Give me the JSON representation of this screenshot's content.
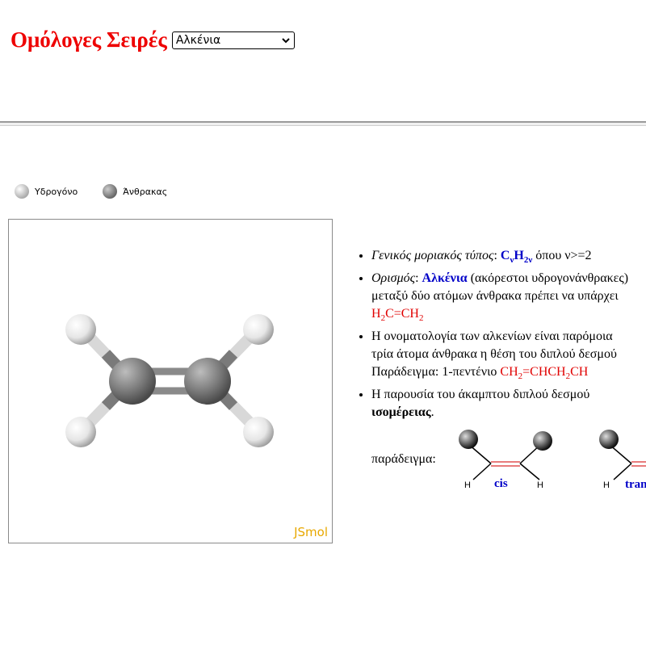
{
  "header": {
    "title": "Ομόλογες Σειρές",
    "select_value": "Αλκένια"
  },
  "legend": {
    "hydrogen": "Υδρογόνο",
    "carbon": "Άνθρακας"
  },
  "viewer": {
    "brand": "JSmol"
  },
  "info": {
    "general_formula_label": "Γενικός μοριακός τύπος",
    "formula_c": "C",
    "formula_c_sub": "ν",
    "formula_h": "H",
    "formula_h_sub": "2ν",
    "formula_tail": " όπου ν>=2",
    "definition_label": "Ορισμός",
    "definition_term": "Αλκένια",
    "definition_line1_rest": " (ακόρεστοι υδρογονάνθρακες)",
    "definition_line2": "μεταξύ δύο ατόμων άνθρακα πρέπει να υπάρχει",
    "example_h2c": "H",
    "example_h2c_sub": "2",
    "example_c_eq_ch": "C=CH",
    "example_ch_sub": "2",
    "nomenclature_line1": "Η ονοματολογία των αλκενίων είναι παρόμοια",
    "nomenclature_line2": "τρία άτομα άνθρακα η θέση του διπλού δεσμού",
    "nomenclature_line3_label": "Παράδειγμα: 1-πεντένιο ",
    "pentene_a": "CH",
    "pentene_a_sub": "2",
    "pentene_b": "=CHCH",
    "pentene_b_sub": "2",
    "pentene_c": "CH",
    "isomer_line1": "Η παρουσία του άκαμπτου διπλού δεσμού",
    "isomer_term": "ισομέρειας",
    "isomer_period": ".",
    "example_label": "παράδειγμα:",
    "cis_label": "cis",
    "trans_label": "trans",
    "h_label": "H"
  },
  "colors": {
    "title": "#ee0000",
    "formula_blue": "#0000c8",
    "formula_red": "#e00000",
    "jsmol": "#e8a800"
  }
}
